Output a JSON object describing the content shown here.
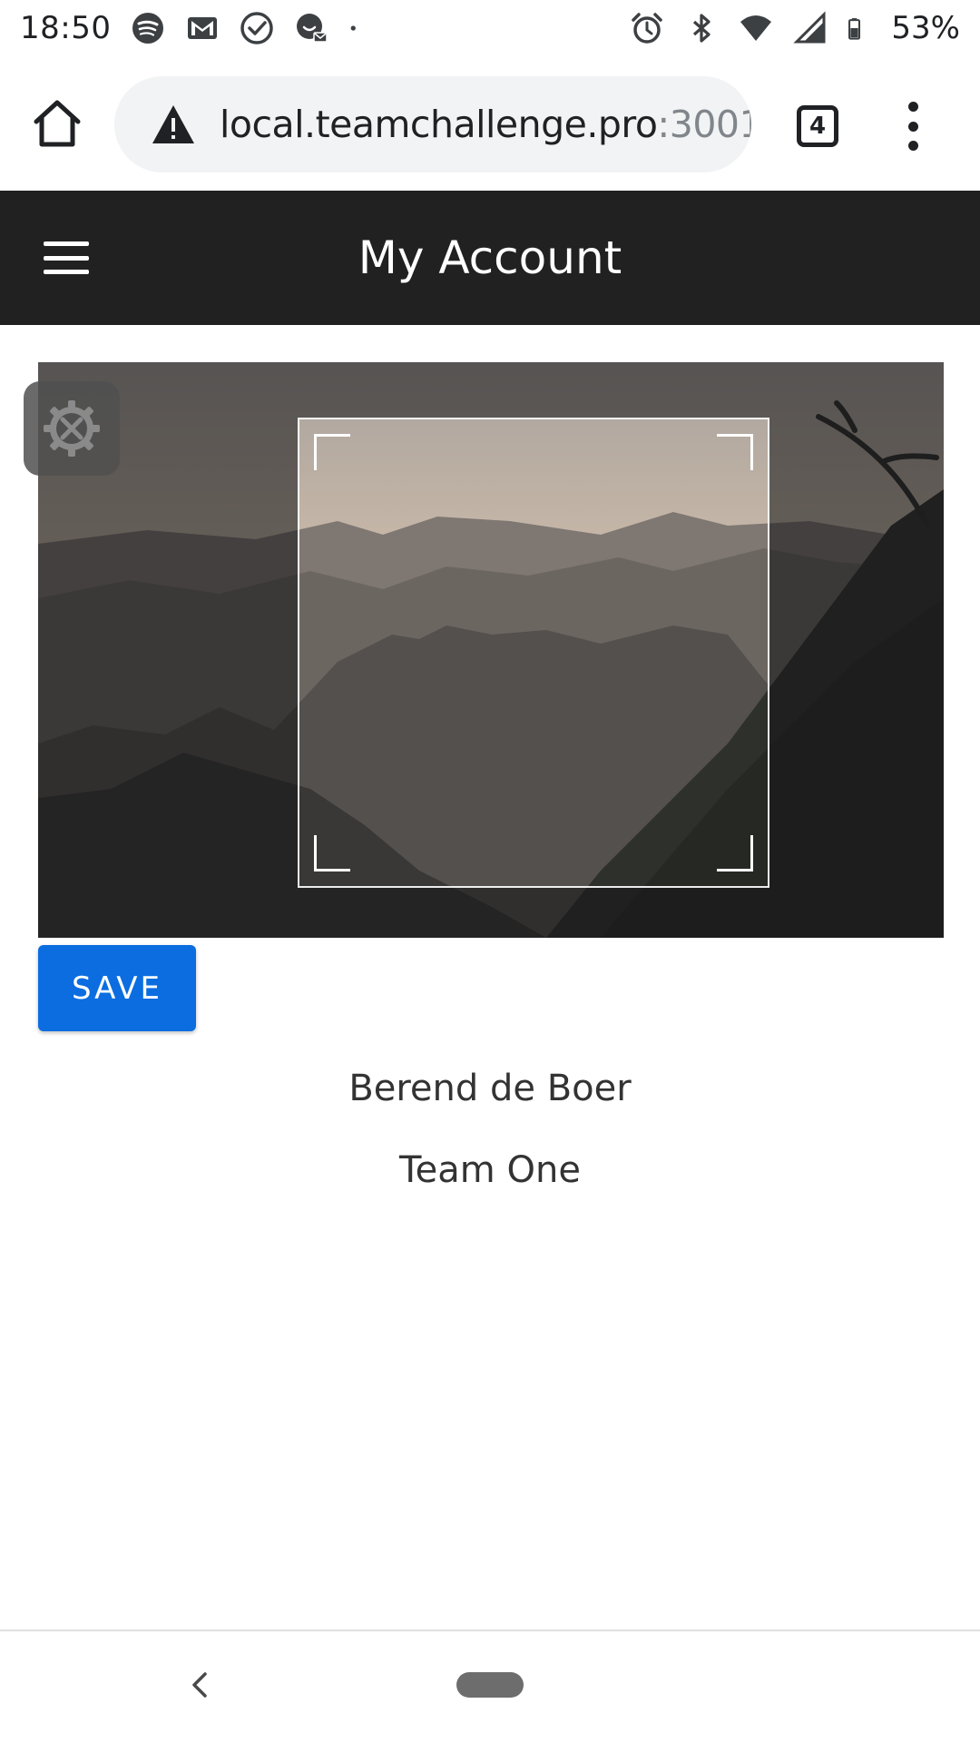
{
  "status_bar": {
    "time": "18:50",
    "left_icons": [
      "spotify-icon",
      "gmail-icon",
      "check-circle-icon",
      "messenger-icon",
      "dot-icon"
    ],
    "right_icons": [
      "alarm-icon",
      "bluetooth-icon",
      "wifi-icon",
      "signal-icon",
      "battery-icon"
    ],
    "battery": "53%"
  },
  "browser": {
    "url_domain": "local.teamchallenge.pro",
    "url_port": ":3001/",
    "tab_count": "4",
    "icons": {
      "home": "home-icon",
      "warning": "warning-icon",
      "menu": "more-vert-icon"
    }
  },
  "header": {
    "title": "My Account",
    "menu_icon": "hamburger-menu-icon"
  },
  "cropper": {
    "settings_icon": "tools-gear-icon"
  },
  "actions": {
    "save_label": "SAVE"
  },
  "profile": {
    "name": "Berend de Boer",
    "team": "Team One"
  },
  "nav": {
    "back_icon": "back-chevron-icon",
    "home_icon": "home-pill-icon"
  },
  "colors": {
    "header_bg": "#212121",
    "save_button": "#0b6de0",
    "url_bar_bg": "#f1f3f4"
  }
}
